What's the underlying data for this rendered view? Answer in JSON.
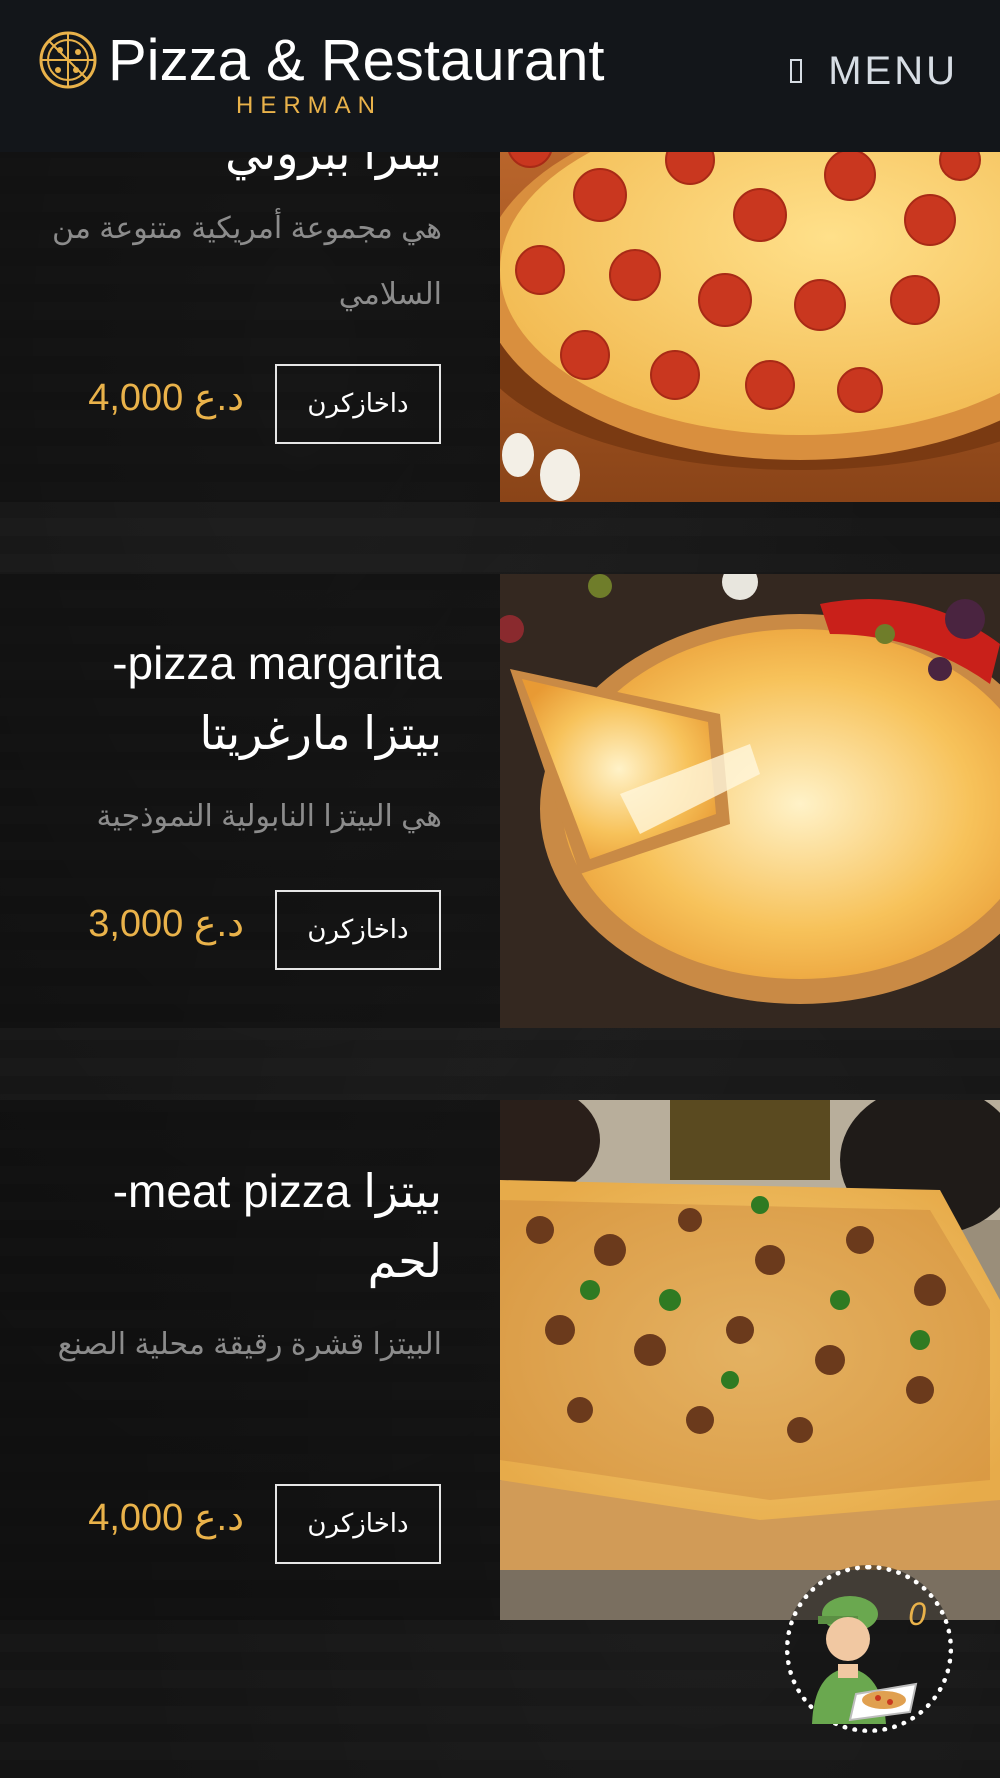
{
  "header": {
    "title": "Pizza & Restaurant",
    "subtitle": "HERMAN",
    "menu_label": "MENU"
  },
  "menu_items": [
    {
      "title": "بيتزا ببروني",
      "description": "هي مجموعة أمريكية متنوعة من السلامي",
      "price": "4,000 د.ع",
      "order_label": "داخازكرن"
    },
    {
      "title": "-pizza margarita بيتزا مارغريتا",
      "description": "هي البيتزا النابولية النموذجية",
      "price": "3,000 د.ع",
      "order_label": "داخازكرن"
    },
    {
      "title": "-meat pizza بيتزا لحم",
      "description": "البيتزا قشرة رقيقة محلية الصنع",
      "price": "4,000 د.ع",
      "order_label": "داخازكرن"
    }
  ],
  "cart": {
    "count": "0"
  },
  "colors": {
    "accent": "#e9b24a",
    "header_bg": "#13161a",
    "page_bg": "#151515"
  }
}
